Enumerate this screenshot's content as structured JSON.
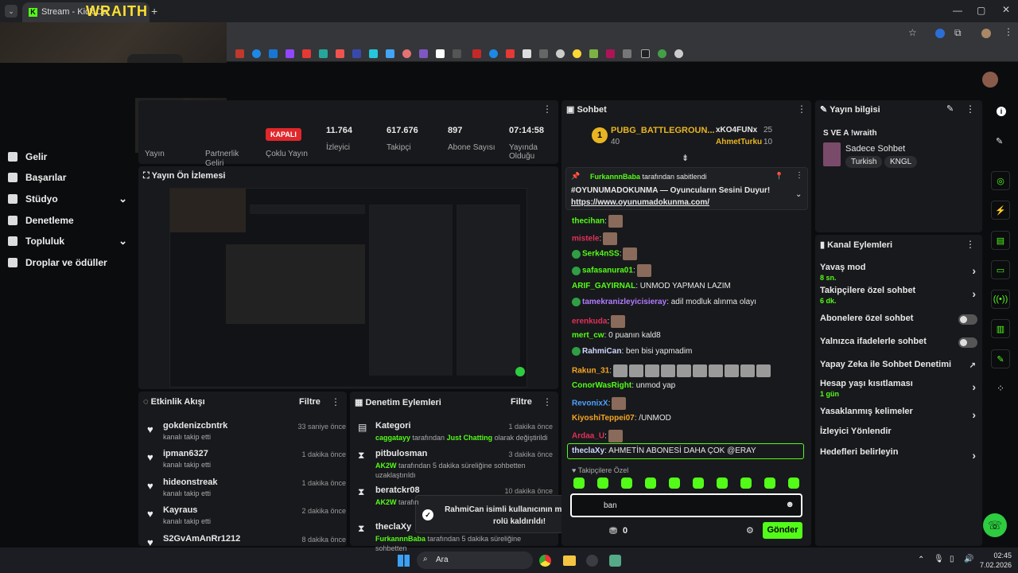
{
  "browser": {
    "tab_title": "Stream - Kick Da",
    "overlay_logo": "WRAITH",
    "tab_plus": "+"
  },
  "leftnav": {
    "items": [
      {
        "label": "Gelir",
        "chev": ""
      },
      {
        "label": "Başarılar",
        "chev": ""
      },
      {
        "label": "Stüdyo",
        "chev": "⌄"
      },
      {
        "label": "Denetleme",
        "chev": ""
      },
      {
        "label": "Topluluk",
        "chev": "⌄"
      },
      {
        "label": "Droplar ve ödüller",
        "chev": ""
      }
    ]
  },
  "stats": {
    "partial_left_1": "Yayın",
    "partial_left_2": "Partnerlik Geliri",
    "status_badge": "KAPALI",
    "multi_stream": "Çoklu Yayın",
    "items": [
      {
        "value": "11.764",
        "label": "İzleyici"
      },
      {
        "value": "617.676",
        "label": "Takipçi"
      },
      {
        "value": "897",
        "label": "Abone Sayısı"
      },
      {
        "value": "07:14:58",
        "label": "Yayında Olduğu"
      }
    ]
  },
  "preview": {
    "title": "Yayın Ön İzlemesi"
  },
  "activity": {
    "title": "Etkinlik Akışı",
    "filter": "Filtre",
    "rows": [
      {
        "name": "gokdenizcbntrk",
        "sub": "kanalı takip etti",
        "time": "33 saniye önce"
      },
      {
        "name": "ipman6327",
        "sub": "kanalı takip etti",
        "time": "1 dakika önce"
      },
      {
        "name": "hideonstreak",
        "sub": "kanalı takip etti",
        "time": "1 dakika önce"
      },
      {
        "name": "Kayraus",
        "sub": "kanalı takip etti",
        "time": "2 dakika önce"
      },
      {
        "name": "S2GvAmAnRr1212",
        "sub": "",
        "time": "8 dakika önce"
      }
    ]
  },
  "moderation": {
    "title": "Denetim Eylemleri",
    "filter": "Filtre",
    "rows": [
      {
        "name": "Kategori",
        "who": "caggatayy",
        "text": " tarafından ",
        "hl": "Just Chatting",
        "rest": " olarak değiştirildi",
        "time": "1 dakika önce",
        "icon": "▤"
      },
      {
        "name": "pitbulosman",
        "who": "AK2W",
        "text": " tarafından 5 dakika süreliğine sohbetten uzaklaştırıldı",
        "hl": "",
        "rest": "",
        "time": "3 dakika önce",
        "icon": "⧗"
      },
      {
        "name": "beratckr08",
        "who": "AK2W",
        "text": " tarafın",
        "hl": "",
        "rest": "",
        "time": "10 dakika önce",
        "icon": "⧗"
      },
      {
        "name": "theclaXy",
        "who": "FurkannnBaba",
        "text": " tarafından 5 dakika süreliğine sohbetten",
        "hl": "",
        "rest": "",
        "time": "",
        "icon": "⧗"
      }
    ]
  },
  "toast": {
    "text": "RahmiCan isimli kullanıcının moderator rolü kaldırıldı!"
  },
  "chat": {
    "title": "Sohbet",
    "leader1_name": "PUBG_BATTLEGROUN...",
    "leader1_count": "40",
    "leader2_name": "xKO4FUNx",
    "leader2_count": "25",
    "leader3_name": "AhmetTurku",
    "leader3_count": "10",
    "pinned_by": "FurkannnBaba",
    "pinned_suffix": " tarafından sabitlendi",
    "pinned_text": "#OYUNUMADOKUNMA — Oyuncuların Sesini Duyur!",
    "pinned_link": "https://www.oyunumadokunma.com/",
    "messages": [
      {
        "user": "thecihan",
        "color": "#53fc18",
        "text": "",
        "emotes": 1
      },
      {
        "user": "mistele",
        "color": "#e0315a",
        "text": "",
        "emotes": 1
      },
      {
        "user": "Serk4nSS",
        "color": "#53fc18",
        "text": "",
        "emotes": 1
      },
      {
        "user": "safasanura01",
        "color": "#53fc18",
        "text": "",
        "emotes": 1
      },
      {
        "user": "ARIF_GAYIRNAL",
        "color": "#53fc18",
        "text": " UNMOD YAPMAN LAZIM",
        "emotes": 0
      },
      {
        "user": "tamekranizleyicisieray",
        "color": "#b07cff",
        "text": " adil modluk alınma olayı",
        "emotes": 0
      },
      {
        "user": "erenkuda",
        "color": "#e0315a",
        "text": "",
        "emotes": 1
      },
      {
        "user": "mert_cw",
        "color": "#53fc18",
        "text": " 0 puanın kald8",
        "emotes": 0
      },
      {
        "user": "RahmiCan",
        "color": "#cfd8ff",
        "text": " ben bisi yapmadim",
        "emotes": 0
      },
      {
        "user": "Rakun_31",
        "color": "#f5a623",
        "text": "",
        "emotes": 10
      },
      {
        "user": "ConorWasRight",
        "color": "#53fc18",
        "text": " unmod yap",
        "emotes": 0
      },
      {
        "user": "RevonixX",
        "color": "#4ea1ff",
        "text": "",
        "emotes": 1
      },
      {
        "user": "KiyoshiTeppei07",
        "color": "#f5a623",
        "text": " /UNMOD",
        "emotes": 0
      },
      {
        "user": "Ardaa_U",
        "color": "#e0315a",
        "text": "",
        "emotes": 1
      }
    ],
    "highlight_user": "theclaXy",
    "highlight_text": " AHMETİN ABONESİ DAHA ÇOK @ERAY",
    "followers_only": "Takipçilere Özel",
    "input_value": "ban",
    "points": "0",
    "send": "Gönder"
  },
  "stream_info": {
    "title": "Yayın bilgisi",
    "stream_title": "S VE A !wraith",
    "category": "Sadece Sohbet",
    "tags": [
      "Turkish",
      "KNGL"
    ]
  },
  "channel_actions": {
    "title": "Kanal Eylemleri",
    "items": [
      {
        "label": "Yavaş mod",
        "sub": "8 sn.",
        "kind": "chevron"
      },
      {
        "label": "Takipçilere özel sohbet",
        "sub": "6 dk.",
        "kind": "chevron"
      },
      {
        "label": "Abonelere özel sohbet",
        "sub": "",
        "kind": "toggle"
      },
      {
        "label": "Yalnızca ifadelerle sohbet",
        "sub": "",
        "kind": "toggle"
      },
      {
        "label": "Yapay Zeka ile Sohbet Denetimi",
        "sub": "",
        "kind": "external"
      },
      {
        "label": "Hesap yaşı kısıtlaması",
        "sub": "1 gün",
        "kind": "chevron"
      },
      {
        "label": "Yasaklanmış kelimeler",
        "sub": "",
        "kind": "chevron"
      },
      {
        "label": "İzleyici Yönlendir",
        "sub": "",
        "kind": "none"
      },
      {
        "label": "Hedefleri belirleyin",
        "sub": "",
        "kind": "chevron"
      }
    ]
  },
  "taskbar": {
    "search": "Ara",
    "time": "02:45",
    "date": "7.02.2026"
  },
  "colors": {
    "accent": "#53fc18",
    "danger": "#e0272b",
    "panel": "#18191c"
  }
}
